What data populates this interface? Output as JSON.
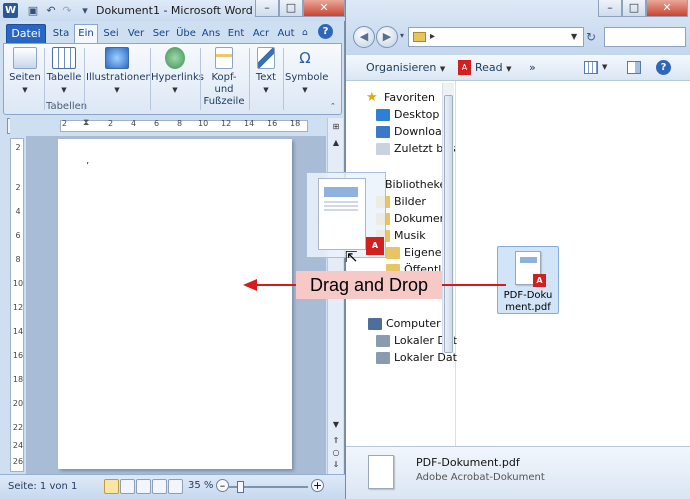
{
  "word": {
    "app_letter": "W",
    "title": "Dokument1 - Microsoft Word",
    "tabs": [
      "Datei",
      "Sta",
      "Ein",
      "Sei",
      "Ver",
      "Ser",
      "Übe",
      "Ans",
      "Ent",
      "Acr",
      "Aut"
    ],
    "selected_tab": "Ein",
    "ribbon": {
      "seiten": "Seiten",
      "tabelle": "Tabelle",
      "tabellen_group": "Tabellen",
      "illustrationen": "Illustrationen",
      "hyperlinks": "Hyperlinks",
      "kopf_fusszeile_1": "Kopf- und",
      "kopf_fusszeile_2": "Fußzeile",
      "text": "Text",
      "symbole": "Symbole"
    },
    "ruler_ticks": [
      "2",
      "2",
      "4",
      "6",
      "8",
      "10",
      "12",
      "14",
      "16",
      "18"
    ],
    "vruler_ticks": [
      "2",
      "2",
      "4",
      "6",
      "8",
      "10",
      "12",
      "14",
      "16",
      "18",
      "20",
      "22",
      "24",
      "26"
    ],
    "status": {
      "page_info": "Seite: 1 von 1",
      "zoom": "35 %"
    }
  },
  "explorer": {
    "address_arrow": "▸",
    "commands": {
      "organize": "Organisieren",
      "read": "Read",
      "more": "»"
    },
    "nav": {
      "favorites": "Favoriten",
      "desktop": "Desktop",
      "downloads": "Downloads",
      "recent": "Zuletzt bes",
      "libraries": "Bibliotheken",
      "pictures": "Bilder",
      "documents": "Dokument",
      "music": "Musik",
      "my_music": "Eigene M",
      "public": "Öffentlic",
      "computer": "Computer",
      "local1": "Lokaler Dat",
      "local2": "Lokaler Dat"
    },
    "file": {
      "name_line1": "PDF-Doku",
      "name_line2": "ment.pdf"
    },
    "details": {
      "filename": "PDF-Dokument.pdf",
      "type": "Adobe Acrobat-Dokument"
    }
  },
  "overlay": {
    "label": "Drag and Drop"
  },
  "colors": {
    "arrow": "#d41c1c",
    "label_bg": "#f6c9c6",
    "file_tab": "#2a66c4"
  }
}
